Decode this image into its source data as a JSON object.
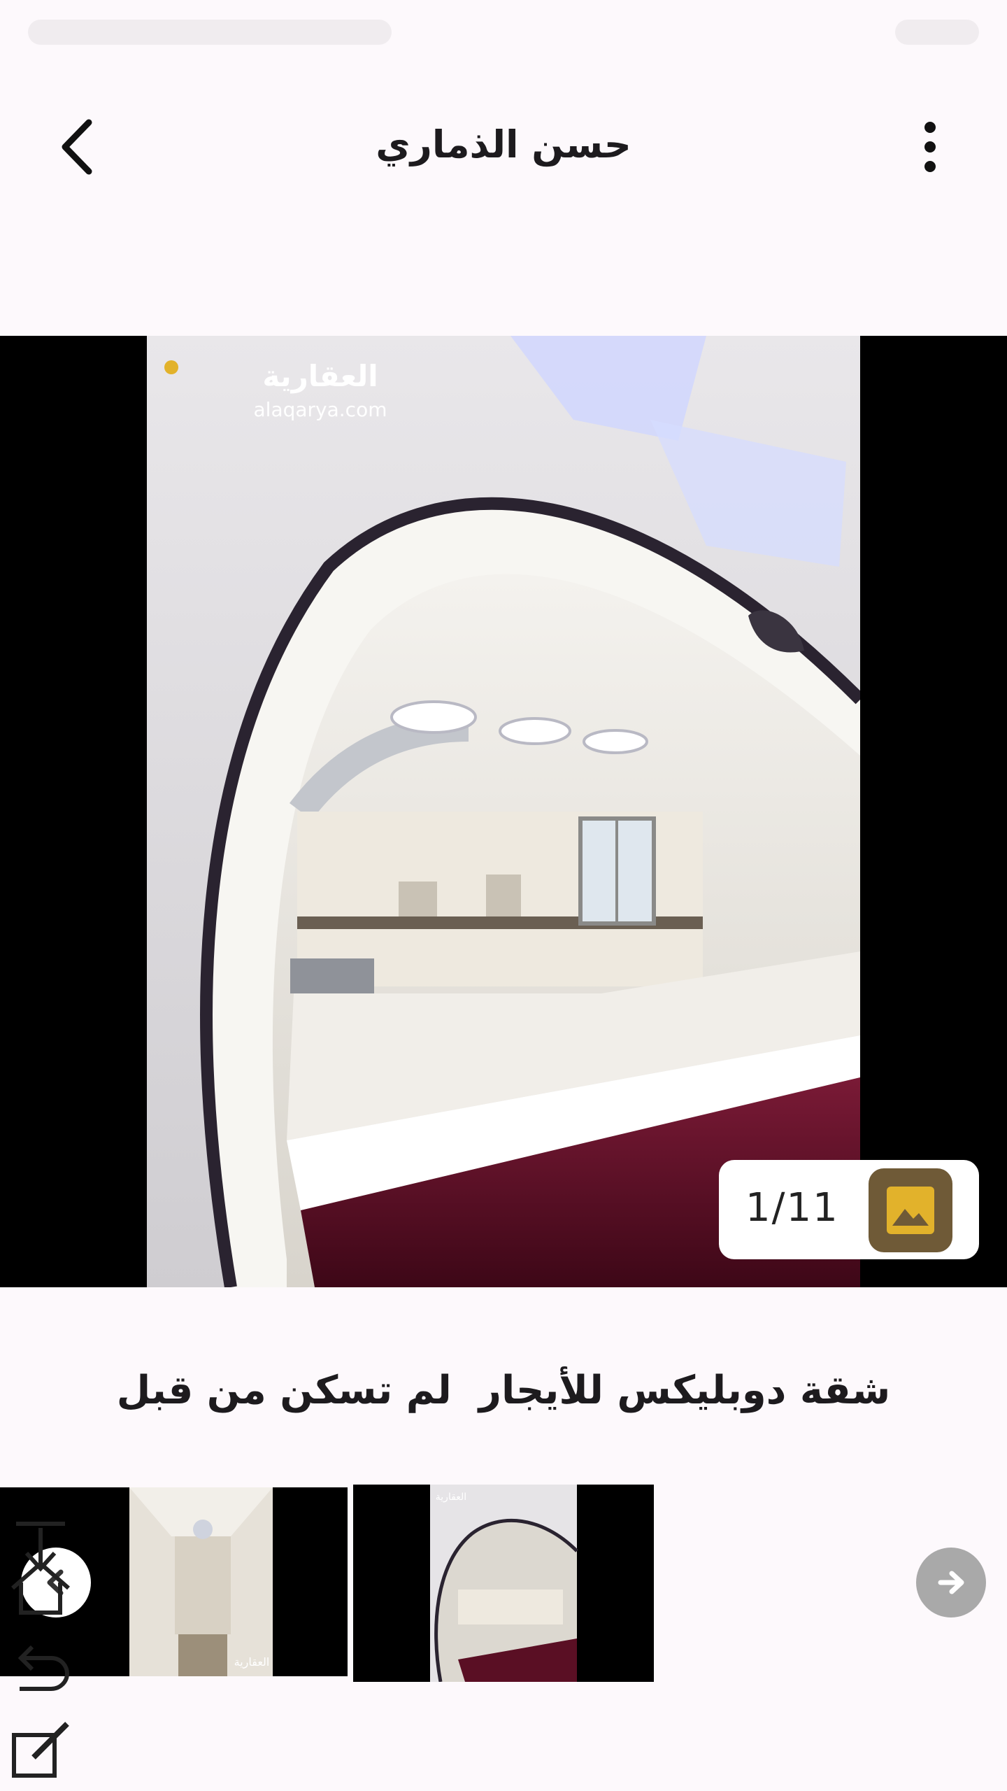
{
  "app_bar": {
    "title": "حسن الذماري",
    "back_icon": "chevron-left-icon",
    "more_icon": "more-vert-icon"
  },
  "hero": {
    "counter": "1/11",
    "gallery_icon": "image-icon",
    "watermark_brand": "العقارية",
    "watermark_site": "alaqarya.com"
  },
  "listing": {
    "caption": "شقة دوبليكس للأيجار  لم تسكن من قبل"
  },
  "thumbnails": {
    "next_icon": "arrow-right-icon",
    "prev_icon": "arrow-left-icon"
  },
  "colors": {
    "accent": "#6f5a37",
    "accent_yellow": "#e2b22b",
    "background": "#fdf9fc",
    "maroon": "#5a0f24"
  }
}
